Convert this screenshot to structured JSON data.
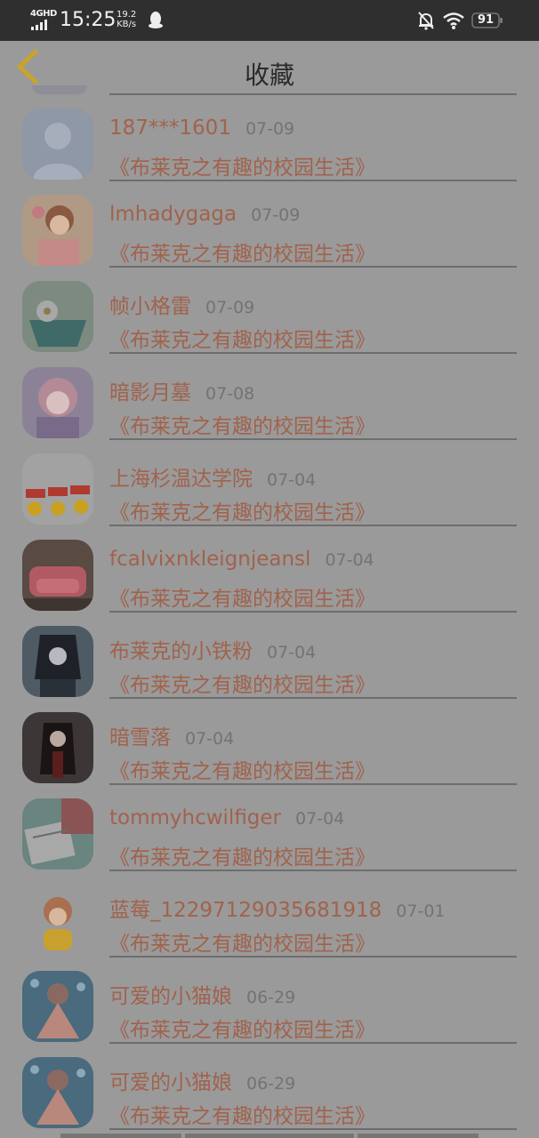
{
  "status_bar": {
    "network": "4GHD",
    "time": "15:25",
    "speed_value": "19.2",
    "speed_unit": "KB/s",
    "battery": "91"
  },
  "header": {
    "title": "收藏"
  },
  "items": [
    {
      "name": "187***1601",
      "date": "07-09",
      "book": "《布莱克之有趣的校园生活》",
      "avatar": "default-avatar-icon"
    },
    {
      "name": "lmhadygaga",
      "date": "07-09",
      "book": "《布莱克之有趣的校园生活》",
      "avatar": "anime-girl-avatar"
    },
    {
      "name": "帧小格雷",
      "date": "07-09",
      "book": "《布莱克之有趣的校园生活》",
      "avatar": "flower-cup-avatar"
    },
    {
      "name": "暗影月墓",
      "date": "07-08",
      "book": "《布莱克之有趣的校园生活》",
      "avatar": "pink-anime-avatar"
    },
    {
      "name": "上海杉温达学院",
      "date": "07-04",
      "book": "《布莱克之有趣的校园生活》",
      "avatar": "okay-emoji-avatar"
    },
    {
      "name": "fcalvixnkleignjeansl",
      "date": "07-04",
      "book": "《布莱克之有趣的校园生活》",
      "avatar": "pink-sofa-avatar"
    },
    {
      "name": "布莱克的小铁粉",
      "date": "07-04",
      "book": "《布莱克之有趣的校园生活》",
      "avatar": "dark-anime-avatar"
    },
    {
      "name": "暗雪落",
      "date": "07-04",
      "book": "《布莱克之有趣的校园生活》",
      "avatar": "dark-hair-girl-avatar"
    },
    {
      "name": "tommyhcwilfiger",
      "date": "07-04",
      "book": "《布莱克之有趣的校园生活》",
      "avatar": "notebook-avatar"
    },
    {
      "name": "蓝莓_12297129035681918",
      "date": "07-01",
      "book": "《布莱克之有趣的校园生活》",
      "avatar": "cute-girl-avatar"
    },
    {
      "name": "可爱的小猫娘",
      "date": "06-29",
      "book": "《布莱克之有趣的校园生活》",
      "avatar": "blue-anime-avatar"
    },
    {
      "name": "可爱的小猫娘",
      "date": "06-29",
      "book": "《布莱克之有趣的校园生活》",
      "avatar": "blue-anime-avatar"
    }
  ]
}
